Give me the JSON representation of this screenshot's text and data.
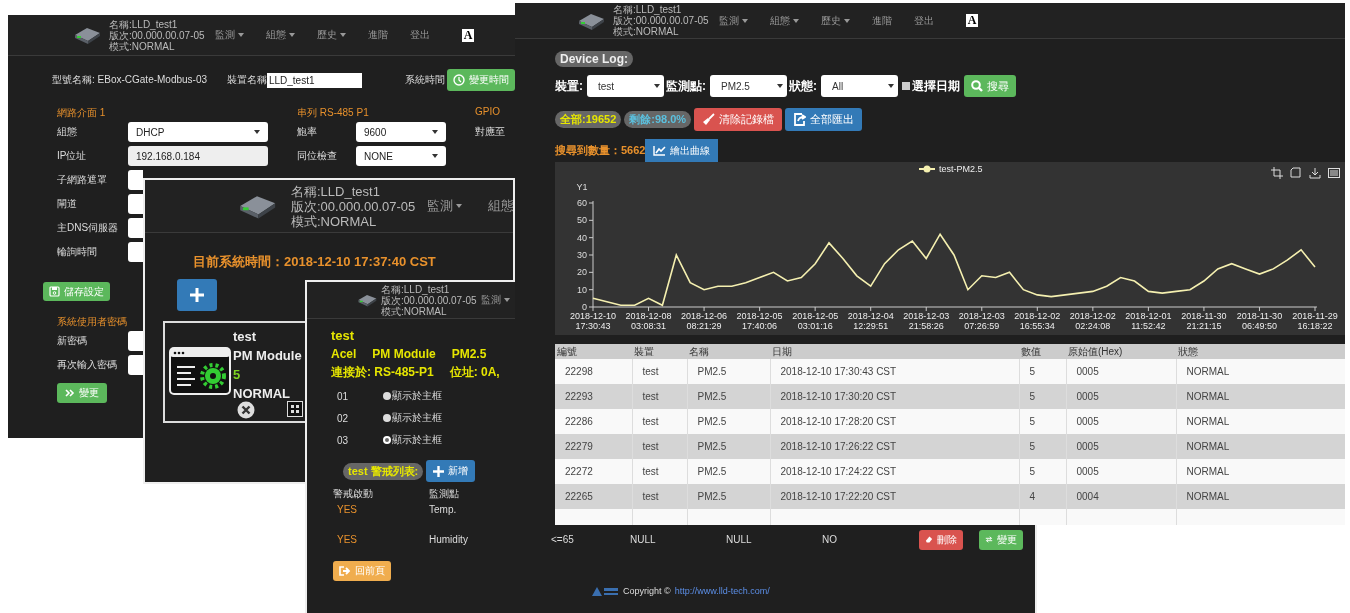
{
  "settings_window": {
    "header": {
      "name": "名稱:LLD_test1",
      "version": "版次:00.000.00.07-05",
      "mode": "模式:NORMAL",
      "menu": [
        {
          "label": "監測",
          "dropdown": true
        },
        {
          "label": "組態",
          "dropdown": true
        },
        {
          "label": "歷史",
          "dropdown": true
        },
        {
          "label": "進階",
          "dropdown": false
        },
        {
          "label": "登出",
          "dropdown": false
        }
      ],
      "font_toggle": "A"
    },
    "model_label": "型號名稱: EBox-CGate-Modbus-03",
    "device_name_label": "裝置名稱",
    "device_name_value": "LLD_test1",
    "system_time_label": "系統時間",
    "change_time_button": "變更時間",
    "network": {
      "title": "網路介面 1",
      "fields": [
        {
          "label": "組態",
          "kind": "select",
          "value": "DHCP"
        },
        {
          "label": "IP位址",
          "kind": "readonly",
          "value": "192.168.0.184"
        },
        {
          "label": "子網路遮罩",
          "kind": "covered"
        },
        {
          "label": "閘道",
          "kind": "covered"
        },
        {
          "label": "主DNS伺服器",
          "kind": "covered"
        },
        {
          "label": "輪詢時間",
          "kind": "covered"
        }
      ]
    },
    "serial": {
      "title": "串列 RS-485 P1",
      "fields": [
        {
          "label": "鮑率",
          "kind": "select",
          "value": "9600"
        },
        {
          "label": "同位檢查",
          "kind": "select",
          "value": "NONE"
        }
      ]
    },
    "gpio": {
      "title": "GPIO",
      "label": "對應至"
    },
    "save_button": "儲存設定",
    "password": {
      "title": "系統使用者密碼",
      "fields": [
        {
          "label": "新密碼"
        },
        {
          "label": "再次輸入密碼"
        }
      ],
      "button": "變更"
    }
  },
  "module_window": {
    "header": {
      "name": "名稱:LLD_test1",
      "version": "版次:00.000.00.07-05",
      "mode": "模式:NORMAL",
      "menu": [
        {
          "label": "監測",
          "dropdown": true
        },
        {
          "label": "組態",
          "dropdown": false
        }
      ]
    },
    "system_time": "目前系統時間：2018-12-10 17:37:40 CST",
    "card": {
      "name": "test",
      "module": "PM Module",
      "value": "5",
      "status": "NORMAL"
    }
  },
  "alert_window": {
    "header": {
      "name": "名稱:LLD_test1",
      "version": "版次:00.000.00.07-05",
      "mode": "模式:NORMAL",
      "menu": [
        {
          "label": "監測",
          "dropdown": true
        }
      ]
    },
    "module_name": "test",
    "module_info": [
      "Acel",
      "PM Module",
      "PM2.5"
    ],
    "connection": [
      "連接於: RS-485-P1",
      "位址: 0A,"
    ],
    "points": [
      {
        "id": "01",
        "label": "顯示於主框",
        "selected": false
      },
      {
        "id": "02",
        "label": "顯示於主框",
        "selected": false
      },
      {
        "id": "03",
        "label": "顯示於主框",
        "selected": true
      }
    ],
    "alert_list_label": "test 警戒列表:",
    "add_button": "新增",
    "alert_columns": [
      "警戒啟動",
      "監測點"
    ],
    "alerts": [
      {
        "enabled": "YES",
        "point": "Temp."
      },
      {
        "enabled": "YES",
        "point": "Humidity",
        "extra": [
          "<=65",
          "NULL",
          "NULL",
          "NO"
        ],
        "delete_button": "刪除",
        "change_button": "變更"
      }
    ],
    "back_button": "回前頁",
    "footer": {
      "copyright": "Copyright ©",
      "link": "http://www.lld-tech.com/"
    }
  },
  "log_window": {
    "header": {
      "name": "名稱:LLD_test1",
      "version": "版次:00.000.00.07-05",
      "mode": "模式:NORMAL",
      "menu": [
        {
          "label": "監測",
          "dropdown": true
        },
        {
          "label": "組態",
          "dropdown": true
        },
        {
          "label": "歷史",
          "dropdown": true
        },
        {
          "label": "進階",
          "dropdown": false
        },
        {
          "label": "登出",
          "dropdown": false
        }
      ],
      "font_toggle": "A"
    },
    "title": "Device Log:",
    "filters": [
      {
        "label": "裝置:",
        "value": "test"
      },
      {
        "label": "監測點:",
        "value": "PM2.5"
      },
      {
        "label": "狀態:",
        "value": "All"
      }
    ],
    "date_checkbox": {
      "label": "選擇日期",
      "checked": false
    },
    "search_button": "搜尋",
    "total_badge": "全部:19652",
    "remaining_badge": "剩餘:98.0%",
    "clear_button": "清除記錄檔",
    "export_button": "全部匯出",
    "found_count": "搜尋到數量：5662",
    "plot_button": "繪出曲線",
    "chart_data": {
      "type": "line",
      "ylabel": "Y1",
      "ylim": [
        0,
        60
      ],
      "yticks": [
        0,
        10,
        20,
        30,
        40,
        50,
        60
      ],
      "categories": [
        "2018-12-10 17:30:43",
        null,
        null,
        null,
        "2018-12-08 03:08:31",
        null,
        null,
        null,
        "2018-12-06 08:21:29",
        null,
        null,
        null,
        "2018-12-05 17:40:06",
        null,
        null,
        null,
        "2018-12-05 03:01:16",
        null,
        null,
        null,
        "2018-12-04 12:29:51",
        null,
        null,
        null,
        "2018-12-03 21:58:26",
        null,
        null,
        null,
        "2018-12-03 07:26:59",
        null,
        null,
        null,
        "2018-12-02 16:55:34",
        null,
        null,
        null,
        "2018-12-02 02:24:08",
        null,
        null,
        null,
        "2018-12-01 11:52:42",
        null,
        null,
        null,
        "2018-11-30 21:21:15",
        null,
        null,
        null,
        "2018-11-30 06:49:50",
        null,
        null,
        null,
        "2018-11-29 16:18:22"
      ],
      "series": [
        {
          "name": "test-PM2.5",
          "color": "#f5f0b0",
          "values": [
            5,
            3,
            1,
            1,
            5,
            1,
            30,
            14,
            10,
            12,
            12,
            14,
            17,
            20,
            15,
            17,
            25,
            37,
            28,
            18,
            12,
            25,
            33,
            38,
            28,
            42,
            30,
            10,
            18,
            17,
            20,
            10,
            7,
            6,
            7,
            8,
            9,
            12,
            17,
            15,
            9,
            8,
            9,
            10,
            15,
            22,
            25,
            22,
            19,
            22,
            27,
            33,
            23
          ]
        }
      ]
    },
    "table": {
      "columns": [
        "編號",
        "裝置",
        "名稱",
        "日期",
        "數值",
        "原始值(Hex)",
        "狀態"
      ],
      "rows": [
        [
          "22298",
          "test",
          "PM2.5",
          "2018-12-10 17:30:43 CST",
          "5",
          "0005",
          "NORMAL"
        ],
        [
          "22293",
          "test",
          "PM2.5",
          "2018-12-10 17:30:20 CST",
          "5",
          "0005",
          "NORMAL"
        ],
        [
          "22286",
          "test",
          "PM2.5",
          "2018-12-10 17:28:20 CST",
          "5",
          "0005",
          "NORMAL"
        ],
        [
          "22279",
          "test",
          "PM2.5",
          "2018-12-10 17:26:22 CST",
          "5",
          "0005",
          "NORMAL"
        ],
        [
          "22272",
          "test",
          "PM2.5",
          "2018-12-10 17:24:22 CST",
          "5",
          "0005",
          "NORMAL"
        ],
        [
          "22265",
          "test",
          "PM2.5",
          "2018-12-10 17:22:20 CST",
          "4",
          "0004",
          "NORMAL"
        ]
      ]
    }
  }
}
